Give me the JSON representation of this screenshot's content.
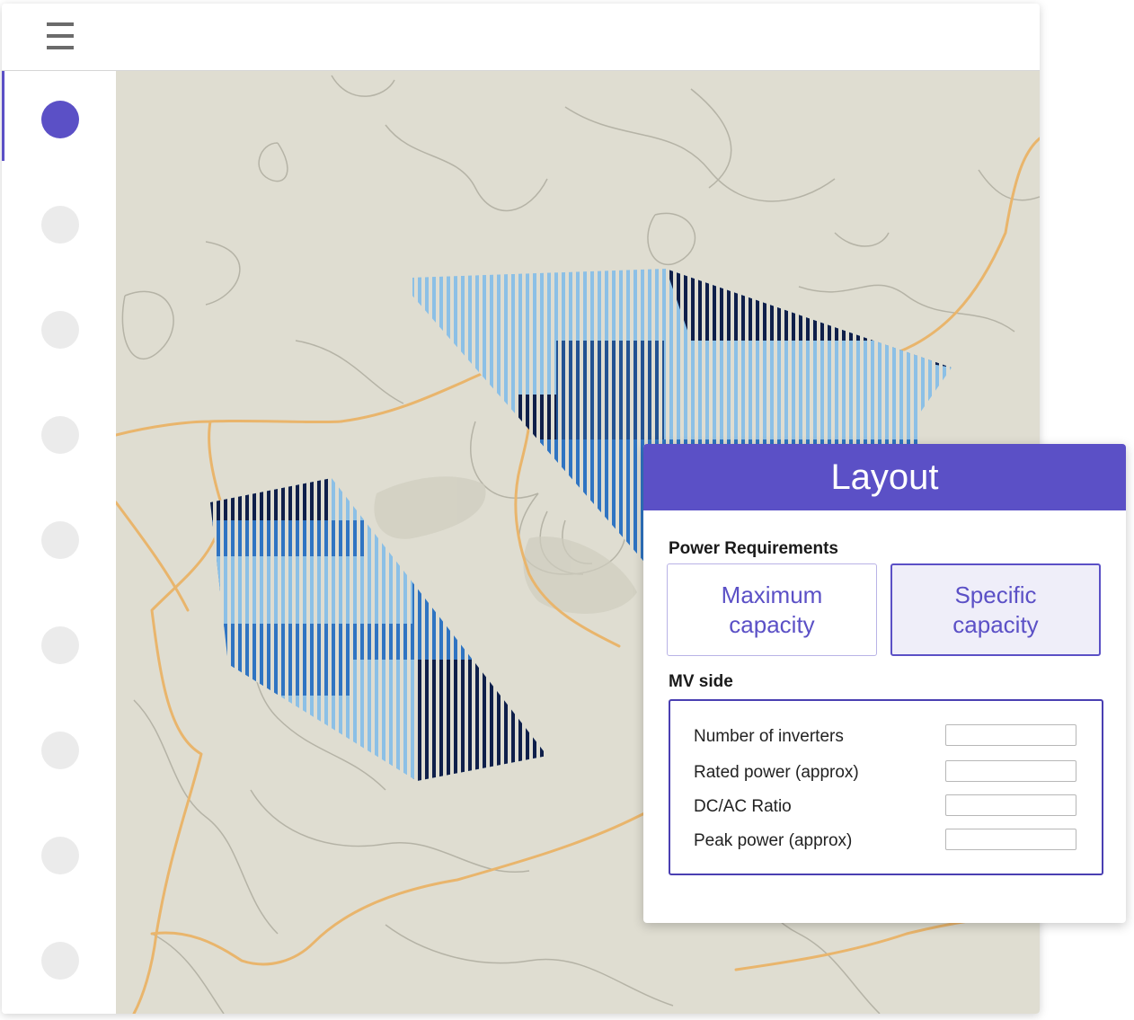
{
  "topbar": {
    "menu_icon": "hamburger-menu-icon"
  },
  "sidebar": {
    "items": [
      {
        "state": "active"
      },
      {
        "state": "inactive"
      },
      {
        "state": "inactive"
      },
      {
        "state": "inactive"
      },
      {
        "state": "inactive"
      },
      {
        "state": "inactive"
      },
      {
        "state": "inactive"
      },
      {
        "state": "inactive"
      },
      {
        "state": "inactive"
      }
    ]
  },
  "colors": {
    "accent": "#5b50c6",
    "map_background": "#dfddd1",
    "road": "#e9b56c",
    "contour": "#b5b3a6",
    "array_light": "#8cc0e6",
    "array_mid": "#2f74c2",
    "array_dark": "#0f1f4a"
  },
  "panel": {
    "title": "Layout",
    "power_requirements": {
      "label": "Power Requirements",
      "options": [
        "Maximum capacity",
        "Specific capacity"
      ],
      "selected": "Specific capacity"
    },
    "mv_side": {
      "label": "MV side",
      "fields": [
        {
          "label": "Number of inverters",
          "value": ""
        },
        {
          "label": "Rated power (approx)",
          "value": ""
        },
        {
          "label": "DC/AC Ratio",
          "value": ""
        },
        {
          "label": "Peak power (approx)",
          "value": ""
        }
      ]
    }
  }
}
